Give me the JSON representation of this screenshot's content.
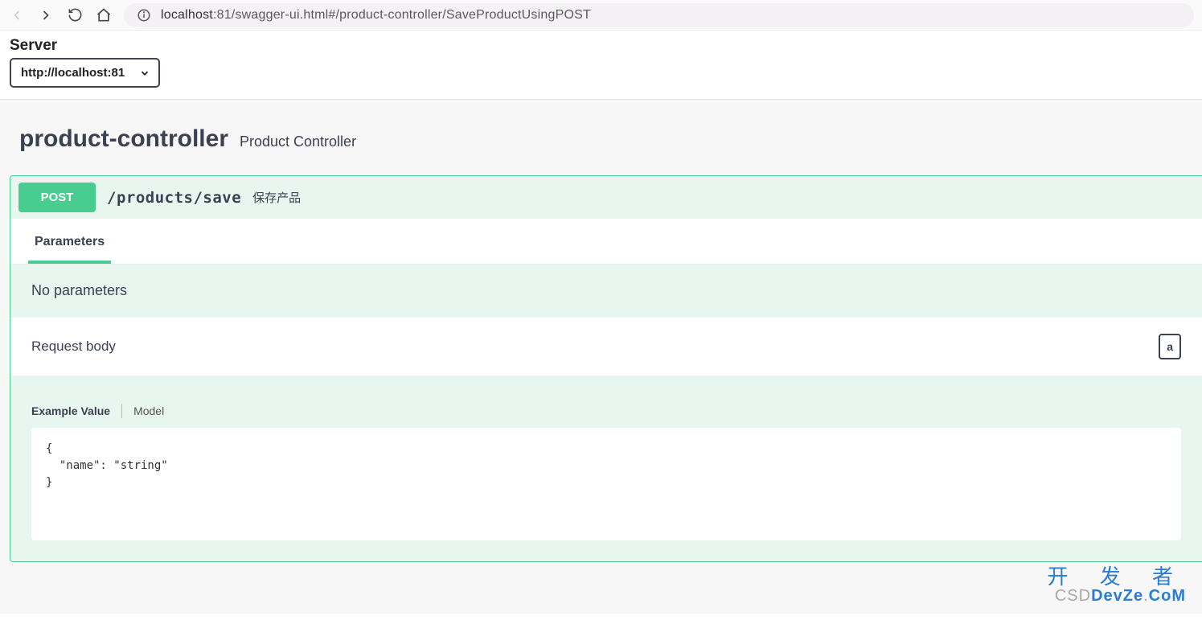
{
  "browser": {
    "url_host": "localhost",
    "url_path": ":81/swagger-ui.html#/product-controller/SaveProductUsingPOST"
  },
  "server": {
    "label": "Server",
    "selected": "http://localhost:81"
  },
  "controller": {
    "name": "product-controller",
    "description": "Product Controller"
  },
  "operation": {
    "method": "POST",
    "path": "/products/save",
    "summary": "保存产品"
  },
  "tabs": {
    "parameters": "Parameters"
  },
  "parameters": {
    "empty_text": "No parameters"
  },
  "request_body": {
    "label": "Request body",
    "right_label": "a",
    "tabs": {
      "example": "Example Value",
      "model": "Model"
    },
    "example": "{\n  \"name\": \"string\"\n}"
  },
  "watermark": {
    "cn": "开 发 者",
    "csdn": "CSD",
    "dev": "DevZe",
    "com": "CoM"
  }
}
